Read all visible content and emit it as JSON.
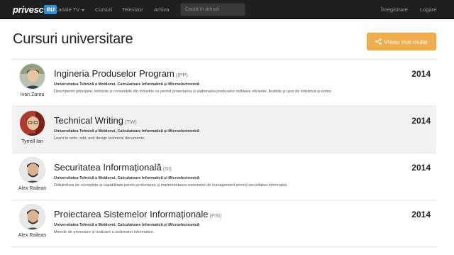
{
  "nav": {
    "logo_text": "privesc",
    "logo_badge": "eu",
    "links": [
      "Canale TV",
      "Cursuri",
      "Televizor",
      "Arhiva"
    ],
    "search_placeholder": "Caută în arhivă",
    "register": "Înregistrare",
    "logout": "Logare"
  },
  "header": {
    "title": "Cursuri universitare",
    "want_more": "Vreau mai multe"
  },
  "courses": [
    {
      "title": "Ingineria Produselor Program",
      "code": "(IPP)",
      "university": "Universitatea Tehnică a Moldovei, Calculatoare Informatică și Microelectronică",
      "description": "Descoperim principiile, tehnicile și convențiile din industrie ce permit proiectarea și elaborarea produselor software eficiente, flexibile și ușor de întreținut și extins.",
      "author": "Ivan Zarea",
      "year": "2014"
    },
    {
      "title": "Technical Writing",
      "code": "(TW)",
      "university": "Universitatea Tehnică a Moldovei, Calculatoare Informatică și Microelectronică",
      "description": "Learn to write, edit, and design technical documents.",
      "author": "Tyrrell Ian",
      "year": "2014"
    },
    {
      "title": "Securitatea Informațională",
      "code": "(SI)",
      "university": "Universitatea Tehnică a Moldovei, Calculatoare Informatică și Microelectronică",
      "description": "Dobândirea de cunoștințe și capabilitate pentru proiectarea și implementarea sistemelor de management privind securitatea informației.",
      "author": "Alex Railean",
      "year": "2014"
    },
    {
      "title": "Proiectarea Sistemelor Informaționale",
      "code": "(PSI)",
      "university": "Universitatea Tehnică a Moldovei, Calculatoare Informatică și Microelectronică",
      "description": "Metode de proiectare și realizare a sistemelor informatice.",
      "author": "Alex Railean",
      "year": "2014"
    }
  ]
}
